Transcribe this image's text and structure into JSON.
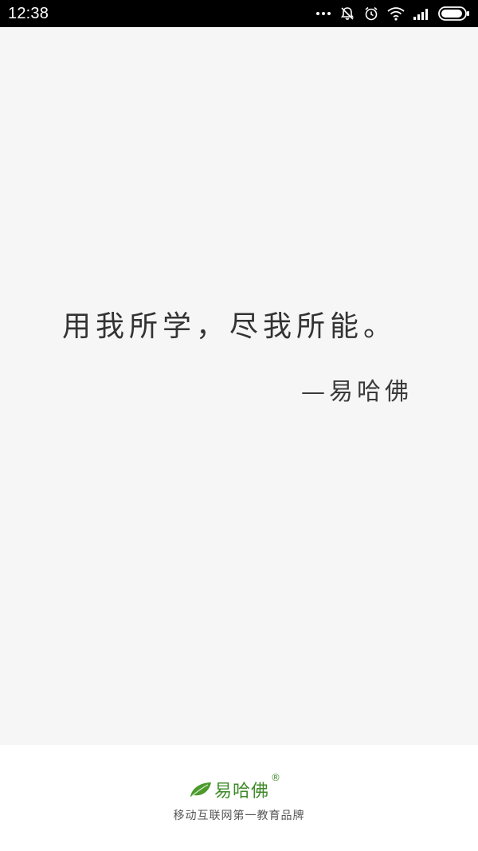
{
  "status_bar": {
    "time": "12:38",
    "icons": [
      "more-dots-icon",
      "notifications-off-icon",
      "alarm-icon",
      "wifi-icon",
      "signal-icon",
      "battery-icon"
    ]
  },
  "splash": {
    "quote": "用我所学，尽我所能。",
    "author": "—易哈佛"
  },
  "footer": {
    "brand_name": "易哈佛",
    "registered_mark": "®",
    "slogan": "移动互联网第一教育品牌",
    "brand_color": "#3f8a2a"
  }
}
